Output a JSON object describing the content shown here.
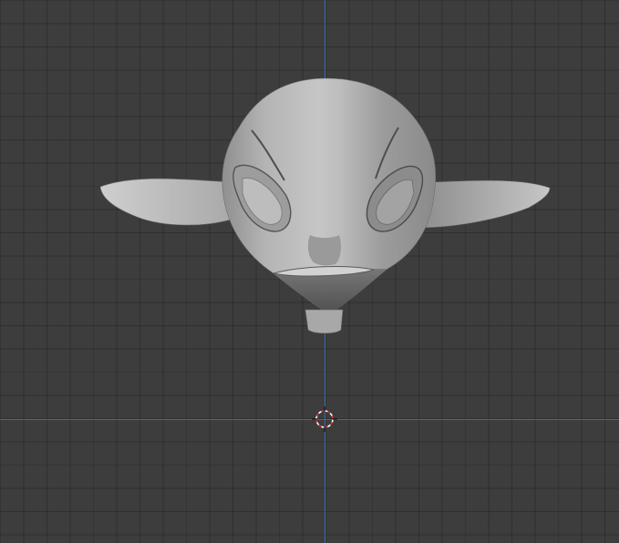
{
  "viewport": {
    "object_icon": "mesh-object-icon",
    "cursor_icon": "3d-cursor-icon"
  },
  "colors": {
    "background": "#3d3d3d",
    "grid_line": "#353535",
    "x_axis": "#c23a4b",
    "y_axis": "#3a6fbf",
    "mesh_light": "#bfbfbf",
    "mesh_mid": "#9a9a9a",
    "mesh_dark": "#5f5f5f"
  }
}
